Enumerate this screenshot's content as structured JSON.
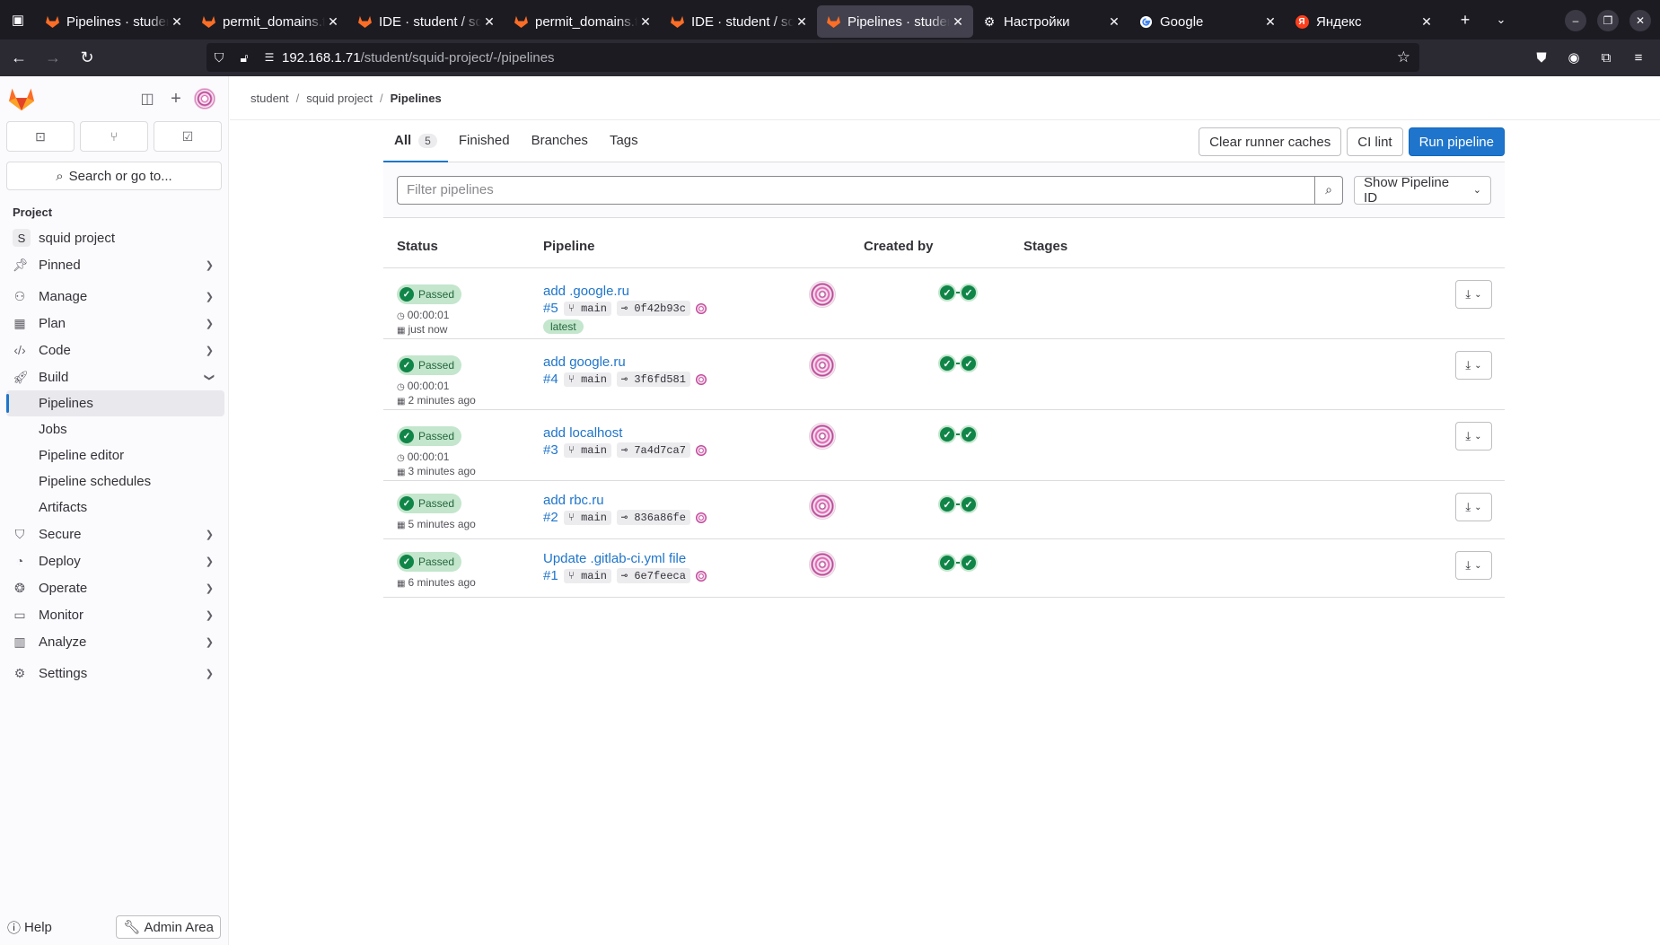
{
  "browser": {
    "tabs": [
      {
        "title": "Pipelines · student",
        "favicon": "gitlab-icon",
        "active": false
      },
      {
        "title": "permit_domains.txt",
        "favicon": "gitlab-icon",
        "active": false
      },
      {
        "title": "IDE · student / squid",
        "favicon": "gitlab-icon",
        "active": false
      },
      {
        "title": "permit_domains.txt",
        "favicon": "gitlab-icon",
        "active": false
      },
      {
        "title": "IDE · student / squid",
        "favicon": "gitlab-icon",
        "active": false
      },
      {
        "title": "Pipelines · student",
        "favicon": "gitlab-icon",
        "active": true
      },
      {
        "title": "Настройки",
        "favicon": "gear-icon",
        "active": false
      },
      {
        "title": "Google",
        "favicon": "google-icon",
        "active": false
      },
      {
        "title": "Яндекс",
        "favicon": "yandex-icon",
        "active": false
      }
    ],
    "url_host": "192.168.1.71",
    "url_path": "/student/squid-project/-/pipelines"
  },
  "sidebar": {
    "search_label": "Search or go to...",
    "section_label": "Project",
    "project_initial": "S",
    "project_name": "squid project",
    "items": [
      {
        "label": "Pinned",
        "icon": "pin-icon"
      },
      {
        "label": "Manage",
        "icon": "users-icon"
      },
      {
        "label": "Plan",
        "icon": "calendar-icon"
      },
      {
        "label": "Code",
        "icon": "code-icon"
      },
      {
        "label": "Build",
        "icon": "rocket-icon"
      }
    ],
    "build_subitems": [
      "Pipelines",
      "Jobs",
      "Pipeline editor",
      "Pipeline schedules",
      "Artifacts"
    ],
    "items_after": [
      {
        "label": "Secure",
        "icon": "shield-icon"
      },
      {
        "label": "Deploy",
        "icon": "deploy-icon"
      },
      {
        "label": "Operate",
        "icon": "operate-icon"
      },
      {
        "label": "Monitor",
        "icon": "monitor-icon"
      },
      {
        "label": "Analyze",
        "icon": "chart-icon"
      }
    ],
    "settings_label": "Settings",
    "help_label": "Help",
    "admin_label": "Admin Area"
  },
  "breadcrumb": {
    "items": [
      "student",
      "squid project",
      "Pipelines"
    ]
  },
  "tabs": {
    "all_label": "All",
    "all_count": "5",
    "finished_label": "Finished",
    "branches_label": "Branches",
    "tags_label": "Tags"
  },
  "actions": {
    "clear_caches": "Clear runner caches",
    "ci_lint": "CI lint",
    "run_pipeline": "Run pipeline"
  },
  "filter": {
    "placeholder": "Filter pipelines",
    "show_id_label": "Show Pipeline ID"
  },
  "table": {
    "headers": {
      "status": "Status",
      "pipeline": "Pipeline",
      "created_by": "Created by",
      "stages": "Stages"
    },
    "rows": [
      {
        "status": "Passed",
        "duration": "00:00:01",
        "time": "just now",
        "title": "add .google.ru",
        "id": "#5",
        "ref": "main",
        "sha": "0f42b93c",
        "latest": "latest"
      },
      {
        "status": "Passed",
        "duration": "00:00:01",
        "time": "2 minutes ago",
        "title": "add google.ru",
        "id": "#4",
        "ref": "main",
        "sha": "3f6fd581"
      },
      {
        "status": "Passed",
        "duration": "00:00:01",
        "time": "3 minutes ago",
        "title": "add localhost",
        "id": "#3",
        "ref": "main",
        "sha": "7a4d7ca7"
      },
      {
        "status": "Passed",
        "time": "5 minutes ago",
        "title": "add rbc.ru",
        "id": "#2",
        "ref": "main",
        "sha": "836a86fe"
      },
      {
        "status": "Passed",
        "time": "6 minutes ago",
        "title": "Update .gitlab-ci.yml file",
        "id": "#1",
        "ref": "main",
        "sha": "6e7feeca"
      }
    ]
  }
}
